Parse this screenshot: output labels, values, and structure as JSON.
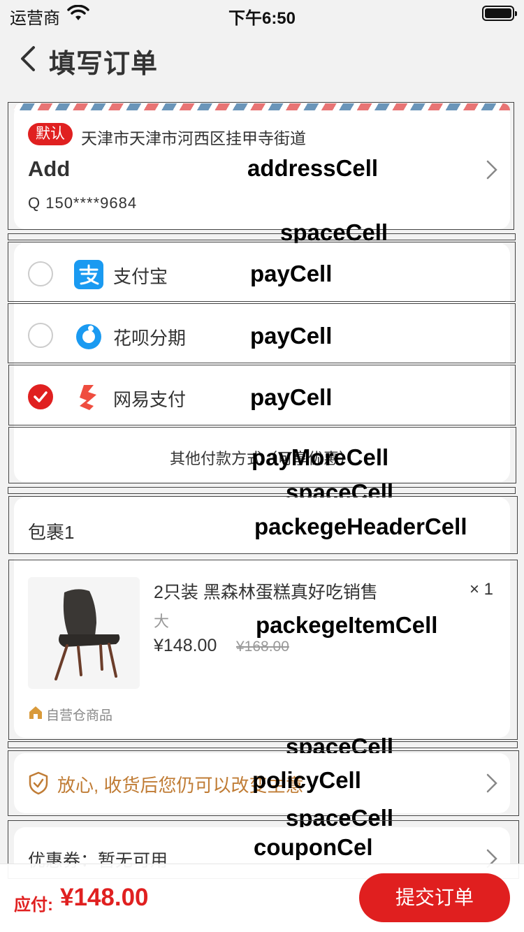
{
  "status_bar": {
    "carrier": "运营商",
    "time": "下午6:50"
  },
  "nav": {
    "title": "填写订单"
  },
  "address": {
    "default_tag": "默认",
    "region": "天津市天津市河西区挂甲寺街道",
    "name": "Add",
    "phone": "Q  150****9684"
  },
  "payment": {
    "options": [
      {
        "label": "支付宝",
        "checked": false,
        "icon": "alipay-icon"
      },
      {
        "label": "花呗分期",
        "checked": false,
        "icon": "huabei-icon"
      },
      {
        "label": "网易支付",
        "checked": true,
        "icon": "netease-pay-icon"
      }
    ],
    "more": "其他付款方式（可享优惠）"
  },
  "package": {
    "header": "包裹1",
    "item": {
      "title": "2只装 黑森林蛋糕真好吃销售",
      "qty": "× 1",
      "spec": "大",
      "price": "¥148.00",
      "old_price": "¥168.00",
      "self_tag": "自营仓商品"
    }
  },
  "policy": {
    "text": "放心, 收货后您仍可以改变主意"
  },
  "coupon": {
    "text": "优惠券：暂无可用"
  },
  "bottom": {
    "total_label": "应付:",
    "total_value": "¥148.00",
    "submit": "提交订单"
  },
  "debug_labels": {
    "address": "addressCell",
    "space1": "spaceCell",
    "pay": "payCell",
    "paymore": "payMoreCell",
    "space2": "spaceCell",
    "pkg_header": "packegeHeaderCell",
    "pkg_item": "packegeItemCell",
    "space3": "spaceCell",
    "policy": "policyCell",
    "space4": "spaceCell",
    "coupon": "couponCel"
  },
  "colors": {
    "accent": "#e02020",
    "policy": "#c07c35",
    "background": "#f2f2f2"
  }
}
